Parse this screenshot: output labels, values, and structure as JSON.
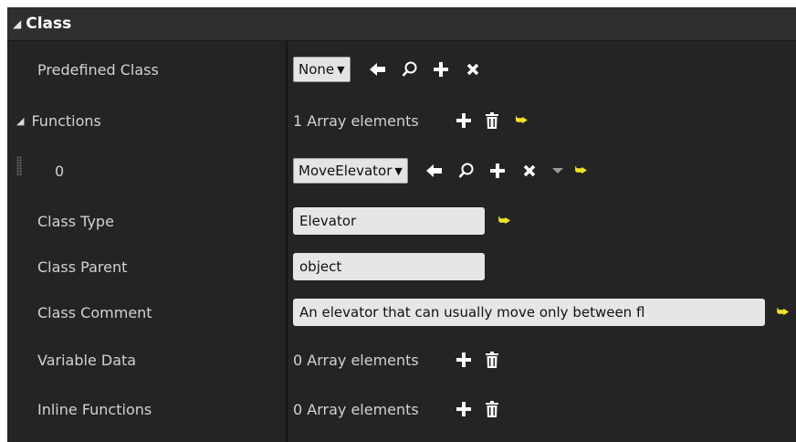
{
  "section": {
    "title": "Class"
  },
  "predefined_class": {
    "label": "Predefined Class",
    "value": "None"
  },
  "functions": {
    "label": "Functions",
    "count_text": "1 Array elements",
    "element": {
      "index": "0",
      "value": "MoveElevator"
    }
  },
  "class_type": {
    "label": "Class Type",
    "value": "Elevator"
  },
  "class_parent": {
    "label": "Class Parent",
    "value": "object"
  },
  "class_comment": {
    "label": "Class Comment",
    "value": "An elevator that can usually move only between fl"
  },
  "variable_data": {
    "label": "Variable Data",
    "count_text": "0 Array elements"
  },
  "inline_functions": {
    "label": "Inline Functions",
    "count_text": "0 Array elements"
  },
  "colors": {
    "panel_bg": "#242424",
    "header_bg": "#2f2f2f",
    "reset_arrow": "#f2e22b",
    "field_bg": "#e6e6e6"
  },
  "icons": [
    "triangle-expanded-icon",
    "arrow-left-icon",
    "search-icon",
    "plus-icon",
    "close-x-icon",
    "trash-icon",
    "reset-arrow-icon",
    "chevron-down-icon",
    "drag-grip-icon"
  ]
}
